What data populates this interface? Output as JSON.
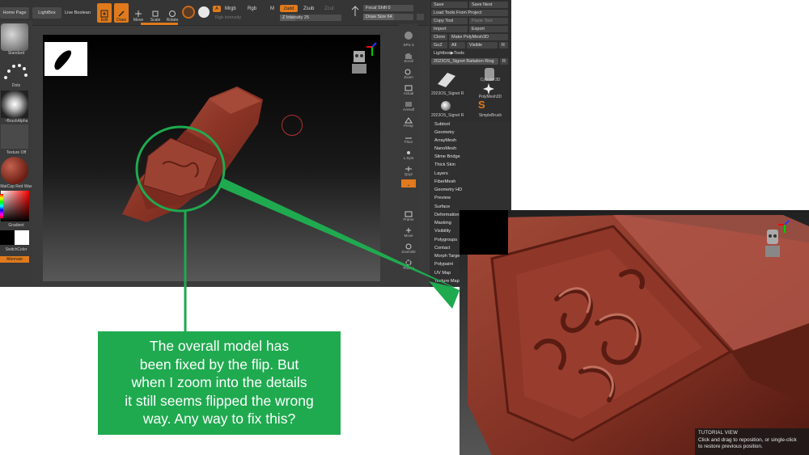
{
  "colors": {
    "accent_orange": "#e07a1c",
    "annotation_green": "#1faa4f",
    "model_red": "#8b3426",
    "ui_dark": "#3b3b3b"
  },
  "toolbar": {
    "home_page": "Home Page",
    "lightbox": "LightBox",
    "live_boolean": "Live Boolean",
    "edit": "Edit",
    "draw": "Draw",
    "move": "Move",
    "scale": "Scale",
    "rotate": "Rotate",
    "a_flag": "A",
    "mrgb": "Mrgb",
    "rgb": "Rgb",
    "m": "M",
    "zadd": "Zadd",
    "zsub": "Zsub",
    "zcut": "Zcut",
    "rgb_intensity": "Rgb Intensity",
    "z_intensity_label": "Z Intensity",
    "z_intensity_value": "25",
    "focal_shift_label": "Focal Shift",
    "focal_shift_value": "0",
    "draw_size_label": "Draw Size",
    "draw_size_value": "64"
  },
  "left_shelf": {
    "brush": "Standard",
    "stroke": "Dots",
    "alpha": "~BrushAlpha",
    "texture": "Texture Off",
    "material": "MatCap Red Wax",
    "gradient": "Gradient",
    "switch_color": "SwitchColor",
    "alternate": "Alternate"
  },
  "right_shelf": {
    "spix": "SPix 3",
    "scroll": "Scroll",
    "zoom": "Zoom",
    "actual": "Actual",
    "aahalf": "AAHalf",
    "persp": "Persp",
    "floor": "Floor",
    "local": "L.Sym",
    "xyz": "Qxyz",
    "frame": "Frame",
    "move": "Move",
    "zoom3d": "Zoom3D",
    "rotate": "Rotate"
  },
  "tool_palette": {
    "save": "Save",
    "save_next": "Save Next",
    "load_tools_from_project": "Load Tools From Project",
    "copy_tool": "Copy Tool",
    "paste_tool": "Paste Tool",
    "import": "Import",
    "export": "Export",
    "clone": "Clone",
    "make_polymesh": "Make PolyMesh3D",
    "goz": "GoZ",
    "all": "All",
    "visible": "Visible",
    "r": "R",
    "lightbox_tools": "Lightbox▶Tools",
    "current_tool": "2023OS_Signet Battalion Ring",
    "r2": "R",
    "thumbs": [
      "2023OS_Signet R",
      "Cylinder3D",
      "2023OS_Signet R",
      "PolyMesh3D",
      "2023OS_Signet R",
      "SimpleBrush"
    ]
  },
  "submenu": [
    "Subtool",
    "Geometry",
    "ArrayMesh",
    "NanoMesh",
    "Slime Bridge",
    "Thick Skin",
    "Layers",
    "FiberMesh",
    "Geometry HD",
    "Preview",
    "Surface",
    "Deformation",
    "Masking",
    "Visibility",
    "Polygroups",
    "Contact",
    "Morph Target",
    "Polypaint",
    "UV Map",
    "Texture Map"
  ],
  "tutorial": {
    "title": "TUTORIAL VIEW",
    "line1": "Click and drag to reposition, or single-click",
    "line2": "to restore previous position."
  },
  "callout": {
    "line1": "The overall model has",
    "line2": "been fixed by the flip. But",
    "line3": "when I zoom into the details",
    "line4": "it still seems flipped the wrong",
    "line5": "way. Any way to fix this?"
  }
}
